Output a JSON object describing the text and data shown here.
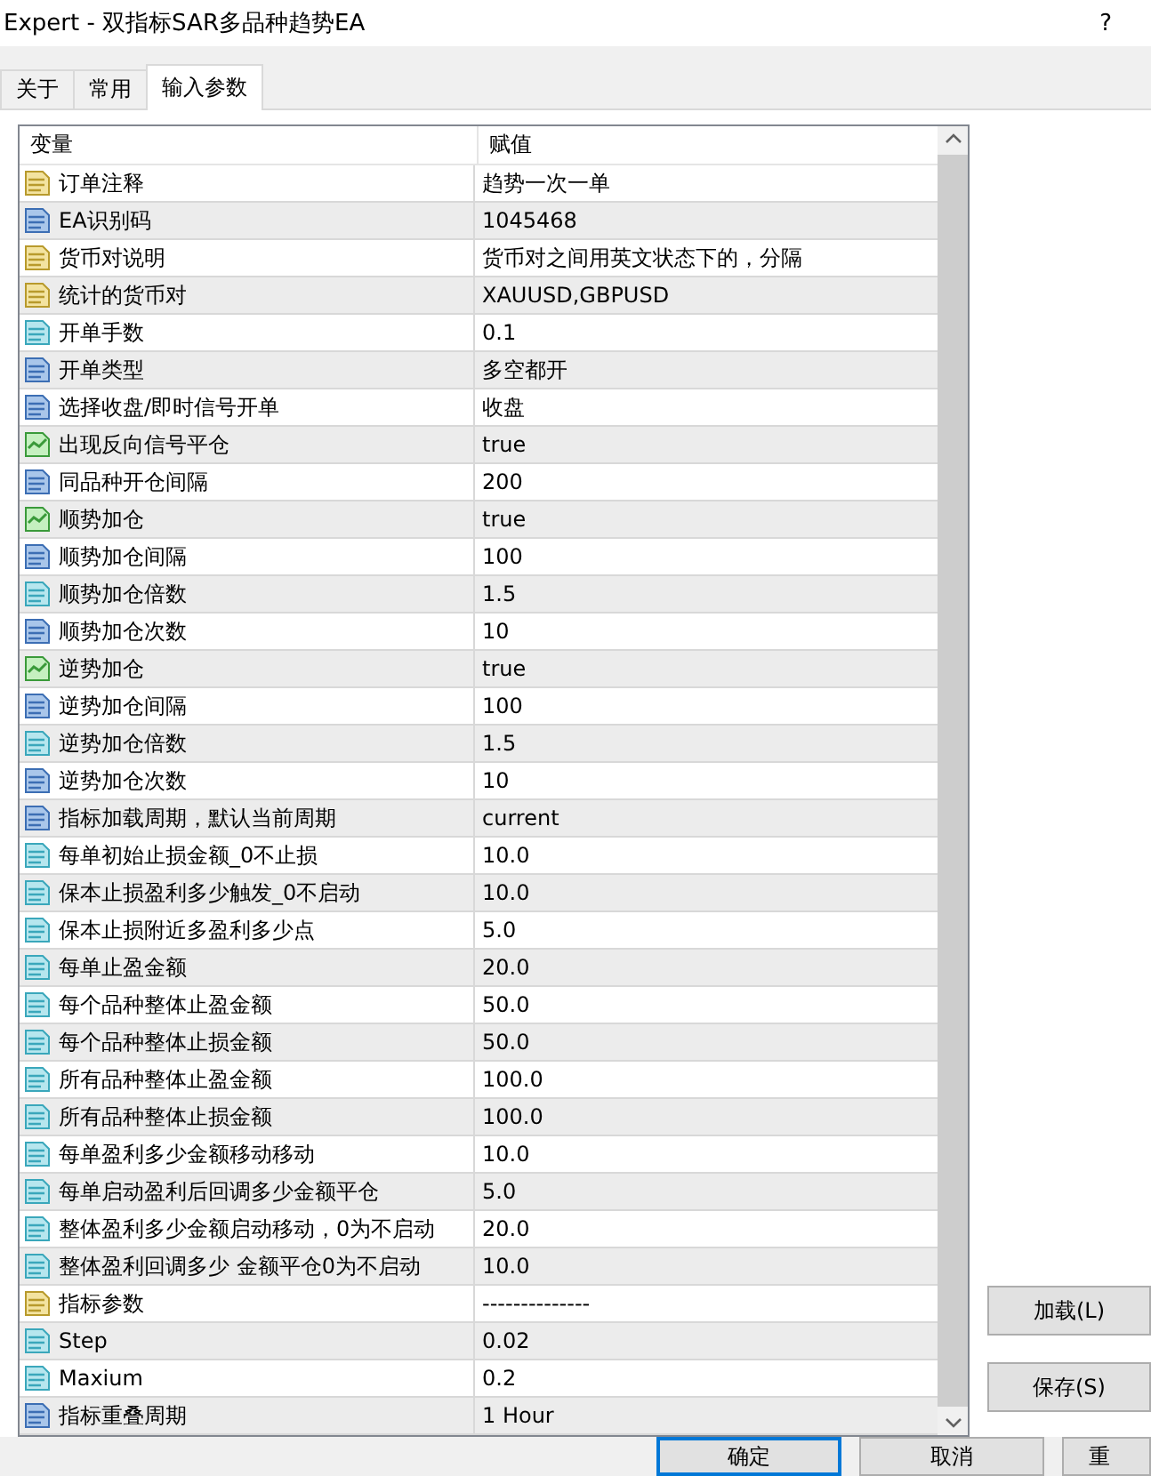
{
  "window": {
    "title": "Expert - 双指标SAR多品种趋势EA",
    "help": "?"
  },
  "tabs": [
    {
      "label": "关于",
      "selected": false
    },
    {
      "label": "常用",
      "selected": false
    },
    {
      "label": "输入参数",
      "selected": true
    }
  ],
  "table": {
    "columns": [
      "变量",
      "赋值"
    ],
    "rows": [
      {
        "kind": "string",
        "name": "订单注释",
        "value": "趋势一次一单"
      },
      {
        "kind": "int",
        "name": "EA识别码",
        "value": "1045468"
      },
      {
        "kind": "string",
        "name": "货币对说明",
        "value": "货币对之间用英文状态下的，分隔"
      },
      {
        "kind": "string",
        "name": "统计的货币对",
        "value": "XAUUSD,GBPUSD"
      },
      {
        "kind": "double",
        "name": "开单手数",
        "value": "0.1"
      },
      {
        "kind": "int",
        "name": "开单类型",
        "value": "多空都开"
      },
      {
        "kind": "int",
        "name": "选择收盘/即时信号开单",
        "value": "收盘"
      },
      {
        "kind": "bool",
        "name": "出现反向信号平仓",
        "value": "true"
      },
      {
        "kind": "int",
        "name": "同品种开仓间隔",
        "value": "200"
      },
      {
        "kind": "bool",
        "name": "顺势加仓",
        "value": "true"
      },
      {
        "kind": "int",
        "name": "顺势加仓间隔",
        "value": "100"
      },
      {
        "kind": "double",
        "name": "顺势加仓倍数",
        "value": "1.5"
      },
      {
        "kind": "int",
        "name": "顺势加仓次数",
        "value": "10"
      },
      {
        "kind": "bool",
        "name": "逆势加仓",
        "value": "true"
      },
      {
        "kind": "int",
        "name": "逆势加仓间隔",
        "value": "100"
      },
      {
        "kind": "double",
        "name": "逆势加仓倍数",
        "value": "1.5"
      },
      {
        "kind": "int",
        "name": "逆势加仓次数",
        "value": "10"
      },
      {
        "kind": "int",
        "name": "指标加载周期，默认当前周期",
        "value": "current"
      },
      {
        "kind": "double",
        "name": "每单初始止损金额_0不止损",
        "value": "10.0"
      },
      {
        "kind": "double",
        "name": "保本止损盈利多少触发_0不启动",
        "value": "10.0"
      },
      {
        "kind": "double",
        "name": "保本止损附近多盈利多少点",
        "value": "5.0"
      },
      {
        "kind": "double",
        "name": "每单止盈金额",
        "value": "20.0"
      },
      {
        "kind": "double",
        "name": "每个品种整体止盈金额",
        "value": "50.0"
      },
      {
        "kind": "double",
        "name": "每个品种整体止损金额",
        "value": "50.0"
      },
      {
        "kind": "double",
        "name": "所有品种整体止盈金额",
        "value": "100.0"
      },
      {
        "kind": "double",
        "name": "所有品种整体止损金额",
        "value": "100.0"
      },
      {
        "kind": "double",
        "name": "每单盈利多少金额移动移动",
        "value": "10.0"
      },
      {
        "kind": "double",
        "name": "每单启动盈利后回调多少金额平仓",
        "value": "5.0"
      },
      {
        "kind": "double",
        "name": "整体盈利多少金额启动移动，0为不启动",
        "value": "20.0"
      },
      {
        "kind": "double",
        "name": "整体盈利回调多少 金额平仓0为不启动",
        "value": "10.0"
      },
      {
        "kind": "string",
        "name": "指标参数",
        "value": "--------------"
      },
      {
        "kind": "double",
        "name": "Step",
        "value": "0.02"
      },
      {
        "kind": "double",
        "name": "Maxium",
        "value": "0.2"
      },
      {
        "kind": "int",
        "name": "指标重叠周期",
        "value": "1 Hour"
      }
    ]
  },
  "side_buttons": [
    "加载(L)",
    "保存(S)"
  ],
  "bottom_buttons": [
    {
      "label": "确定",
      "default": true
    },
    {
      "label": "取消",
      "default": false
    },
    {
      "label": "重",
      "default": false
    }
  ]
}
